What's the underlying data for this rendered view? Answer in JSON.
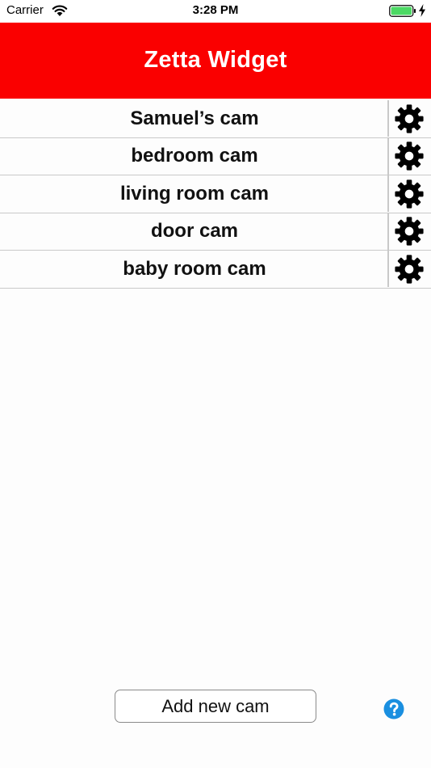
{
  "status_bar": {
    "carrier": "Carrier",
    "time": "3:28 PM",
    "battery_color": "#4cd964"
  },
  "nav": {
    "title": "Zetta Widget",
    "background_color": "#fa0000"
  },
  "cams": [
    {
      "name": "Samuel’s cam",
      "settings_icon": "gear-icon"
    },
    {
      "name": "bedroom cam",
      "settings_icon": "gear-icon"
    },
    {
      "name": "living room cam",
      "settings_icon": "gear-icon"
    },
    {
      "name": "door cam",
      "settings_icon": "gear-icon"
    },
    {
      "name": "baby room cam",
      "settings_icon": "gear-icon"
    }
  ],
  "footer": {
    "add_button_label": "Add new cam",
    "help_icon": "help-icon",
    "help_icon_color": "#1a8fe0"
  }
}
